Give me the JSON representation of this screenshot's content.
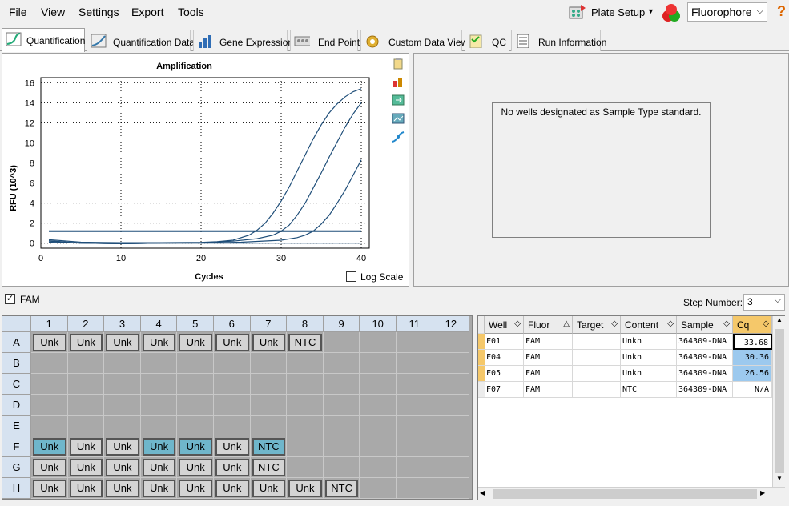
{
  "menu": [
    "File",
    "View",
    "Settings",
    "Export",
    "Tools"
  ],
  "toolbar": {
    "plate_setup": "Plate Setup",
    "fluorophore": "Fluorophore",
    "help": "?"
  },
  "tabs": [
    "Quantification",
    "Quantification Data",
    "Gene Expression",
    "End Point",
    "Custom Data View",
    "QC",
    "Run Information"
  ],
  "chart_data": {
    "type": "line",
    "title": "Amplification",
    "xlabel": "Cycles",
    "ylabel": "RFU (10^3)",
    "xlim": [
      0,
      41
    ],
    "ylim": [
      -0.5,
      16.5
    ],
    "xticks": [
      0,
      10,
      20,
      30,
      40
    ],
    "yticks": [
      0,
      2,
      4,
      6,
      8,
      10,
      12,
      14,
      16
    ],
    "threshold": 1.2,
    "grid": true,
    "series": [
      {
        "x": [
          1,
          5,
          10,
          15,
          20,
          22,
          24,
          26,
          27,
          28,
          29,
          30,
          31,
          32,
          33,
          34,
          35,
          36,
          37,
          38,
          39,
          40
        ],
        "y": [
          0.35,
          0.1,
          0.05,
          0.05,
          0.08,
          0.15,
          0.3,
          0.8,
          1.3,
          2.0,
          3.0,
          4.2,
          5.6,
          7.2,
          8.8,
          10.4,
          11.8,
          13.0,
          13.9,
          14.6,
          15.1,
          15.4
        ]
      },
      {
        "x": [
          1,
          5,
          10,
          15,
          20,
          24,
          27,
          29,
          30,
          31,
          32,
          33,
          34,
          35,
          36,
          37,
          38,
          39,
          40
        ],
        "y": [
          0.25,
          0.0,
          -0.05,
          0.0,
          0.05,
          0.2,
          0.45,
          0.8,
          1.2,
          1.8,
          2.8,
          4.0,
          5.5,
          7.0,
          8.6,
          10.1,
          11.6,
          12.9,
          14.0
        ]
      },
      {
        "x": [
          1,
          5,
          10,
          15,
          20,
          25,
          30,
          32,
          33,
          34,
          35,
          36,
          37,
          38,
          39,
          40
        ],
        "y": [
          0.2,
          0.0,
          -0.05,
          0.0,
          0.02,
          0.1,
          0.3,
          0.55,
          0.8,
          1.2,
          1.9,
          2.8,
          4.0,
          5.3,
          6.8,
          8.3
        ]
      },
      {
        "x": [
          1,
          5,
          10,
          15,
          20,
          25,
          30,
          35,
          40
        ],
        "y": [
          0.1,
          0.0,
          -0.05,
          0.0,
          0.0,
          0.0,
          0.0,
          0.0,
          0.0
        ]
      }
    ]
  },
  "log_scale_label": "Log Scale",
  "std_message": "No wells designated as Sample Type standard.",
  "fam_label": "FAM",
  "step_label": "Step Number:",
  "step_value": "3",
  "plate": {
    "cols": [
      "1",
      "2",
      "3",
      "4",
      "5",
      "6",
      "7",
      "8",
      "9",
      "10",
      "11",
      "12"
    ],
    "rows": [
      "A",
      "B",
      "C",
      "D",
      "E",
      "F",
      "G",
      "H"
    ],
    "wells": [
      [
        "Unk",
        "Unk",
        "Unk",
        "Unk",
        "Unk",
        "Unk",
        "Unk",
        "NTC",
        "",
        "",
        "",
        ""
      ],
      [
        "",
        "",
        "",
        "",
        "",
        "",
        "",
        "",
        "",
        "",
        "",
        ""
      ],
      [
        "",
        "",
        "",
        "",
        "",
        "",
        "",
        "",
        "",
        "",
        "",
        ""
      ],
      [
        "",
        "",
        "",
        "",
        "",
        "",
        "",
        "",
        "",
        "",
        "",
        ""
      ],
      [
        "",
        "",
        "",
        "",
        "",
        "",
        "",
        "",
        "",
        "",
        "",
        ""
      ],
      [
        "Unk",
        "Unk",
        "Unk",
        "Unk",
        "Unk",
        "Unk",
        "NTC",
        "",
        "",
        "",
        "",
        ""
      ],
      [
        "Unk",
        "Unk",
        "Unk",
        "Unk",
        "Unk",
        "Unk",
        "NTC",
        "",
        "",
        "",
        "",
        ""
      ],
      [
        "Unk",
        "Unk",
        "Unk",
        "Unk",
        "Unk",
        "Unk",
        "Unk",
        "Unk",
        "NTC",
        "",
        "",
        ""
      ]
    ],
    "selected": [
      "F1",
      "F4",
      "F5",
      "F7"
    ]
  },
  "table": {
    "headers": [
      "Well",
      "Fluor",
      "Target",
      "Content",
      "Sample",
      "Cq"
    ],
    "rows": [
      [
        "F01",
        "FAM",
        "",
        "Unkn",
        "364309-DNA",
        "33.68"
      ],
      [
        "F04",
        "FAM",
        "",
        "Unkn",
        "364309-DNA",
        "30.36"
      ],
      [
        "F05",
        "FAM",
        "",
        "Unkn",
        "364309-DNA",
        "26.56"
      ],
      [
        "F07",
        "FAM",
        "",
        "NTC",
        "364309-DNA",
        "N/A"
      ]
    ]
  },
  "colors": {
    "curve": "#1f4e79",
    "threshold": "#1f4e79",
    "selected_well": "#6fb6cb",
    "cq_highlight": "#9cc9ee"
  }
}
